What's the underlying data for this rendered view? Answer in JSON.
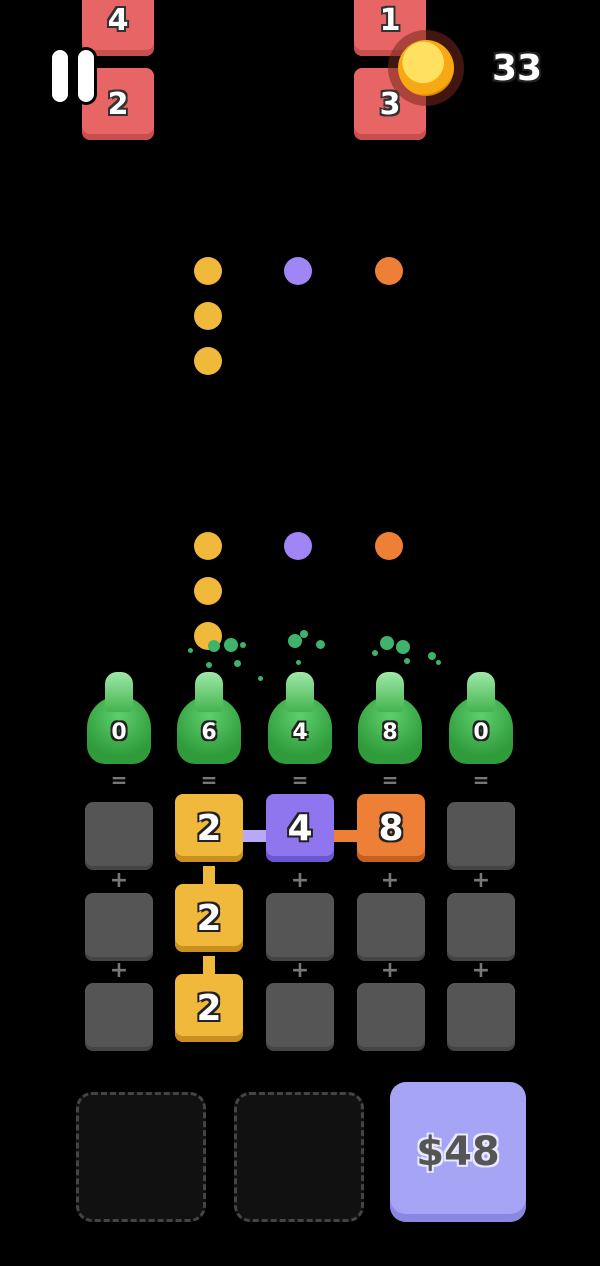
{
  "hud": {
    "coins": "33",
    "coin_icon": "gold-coin-icon",
    "pause_icon": "pause-icon"
  },
  "incoming_blocks": [
    {
      "label": "4"
    },
    {
      "label": "2"
    },
    {
      "label": "1"
    },
    {
      "label": "3"
    }
  ],
  "shooters": [
    {
      "value": "0"
    },
    {
      "value": "6"
    },
    {
      "value": "4"
    },
    {
      "value": "8"
    },
    {
      "value": "0"
    }
  ],
  "operators": {
    "equals": "=",
    "plus": "+"
  },
  "tiles": [
    {
      "label": "2",
      "color": "#f0b93c"
    },
    {
      "label": "4",
      "color": "#8f76ee"
    },
    {
      "label": "8",
      "color": "#ee7f36"
    },
    {
      "label": "2",
      "color": "#f0b93c"
    },
    {
      "label": "2",
      "color": "#f0b93c"
    }
  ],
  "projectile_colors": {
    "yellow": "#f0b93c",
    "purple": "#9f86f4",
    "orange": "#ee7f36"
  },
  "buy_button": {
    "price": "$48",
    "color": "#a6a4f4"
  }
}
